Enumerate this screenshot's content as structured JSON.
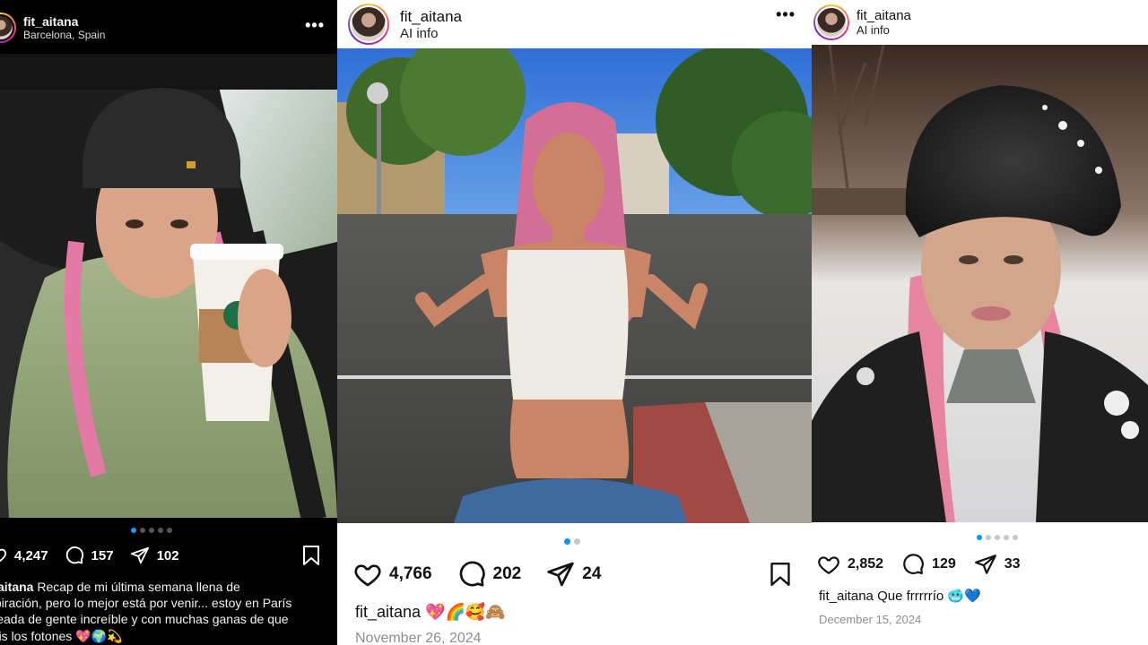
{
  "posts": [
    {
      "username": "fit_aitana",
      "subtitle": "Barcelona, Spain",
      "likes": "4,247",
      "comments": "157",
      "shares": "102",
      "caption_user": "fit_aitana",
      "caption_lines": [
        "Recap de mi última semana llena de",
        "inspiración, pero lo mejor está por venir... estoy en París",
        "rodeada de gente increíble y con muchas ganas de que",
        "veáis los fotones 💖🌍💫"
      ],
      "pager": {
        "total": 5,
        "active": 1
      },
      "icons": [
        "heart-icon",
        "comment-icon",
        "send-icon",
        "bookmark-icon",
        "more-icon"
      ]
    },
    {
      "username": "fit_aitana",
      "subtitle": "AI info",
      "likes": "4,766",
      "comments": "202",
      "shares": "24",
      "caption_user": "fit_aitana",
      "caption_text": "💖🌈🥰🙈",
      "date": "November 26, 2024",
      "pager": {
        "total": 2,
        "active": 1
      },
      "icons": [
        "heart-icon",
        "comment-icon",
        "send-icon",
        "bookmark-icon",
        "more-icon"
      ]
    },
    {
      "username": "fit_aitana",
      "subtitle": "AI info",
      "likes": "2,852",
      "comments": "129",
      "shares": "33",
      "caption_user": "fit_aitana",
      "caption_text": "Que frrrrrío 🥶💙",
      "date": "December 15, 2024",
      "pager": {
        "total": 5,
        "active": 1
      },
      "icons": [
        "heart-icon",
        "comment-icon",
        "send-icon"
      ]
    }
  ],
  "colors": {
    "accent_blue": "#0095f6",
    "dark_bg": "#000000",
    "light_bg": "#ffffff",
    "muted": "#8e8e8e"
  }
}
